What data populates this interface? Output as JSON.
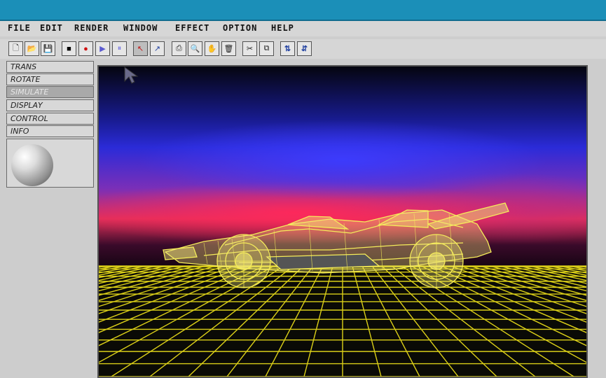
{
  "menu": {
    "items": [
      "FILE",
      "EDIT",
      "RENDER",
      "WINDOW",
      "EFFECT",
      "OPTION",
      "HELP"
    ]
  },
  "toolbar": {
    "buttons": [
      {
        "icon": "new-document-icon",
        "glyph": "🗋"
      },
      {
        "icon": "open-folder-icon",
        "glyph": "📂"
      },
      {
        "icon": "save-disk-icon",
        "glyph": "💾"
      },
      {
        "icon": "stop-icon",
        "glyph": "■"
      },
      {
        "icon": "record-icon",
        "glyph": "●"
      },
      {
        "icon": "play-icon",
        "glyph": "▶"
      },
      {
        "icon": "pause-icon",
        "glyph": "⏸"
      },
      {
        "icon": "select-arrow-icon",
        "glyph": "↖"
      },
      {
        "icon": "move-arrow-icon",
        "glyph": "↗"
      },
      {
        "icon": "print-icon",
        "glyph": "⎙"
      },
      {
        "icon": "zoom-icon",
        "glyph": "🔍"
      },
      {
        "icon": "hand-icon",
        "glyph": "✋"
      },
      {
        "icon": "trash-icon",
        "glyph": "🗑"
      },
      {
        "icon": "cut-icon",
        "glyph": "✂"
      },
      {
        "icon": "copy-icon",
        "glyph": "⧉"
      },
      {
        "icon": "sort-up-icon",
        "glyph": "⇅"
      },
      {
        "icon": "sort-down-icon",
        "glyph": "⇵"
      }
    ]
  },
  "sidebar": {
    "items": [
      "TRANS",
      "ROTATE",
      "SIMULATE",
      "DISPLAY",
      "CONTROL",
      "INFO"
    ],
    "active_index": 2
  },
  "viewport": {
    "grid_color": "#f2e51a",
    "model_color": "#f5ec5a"
  }
}
